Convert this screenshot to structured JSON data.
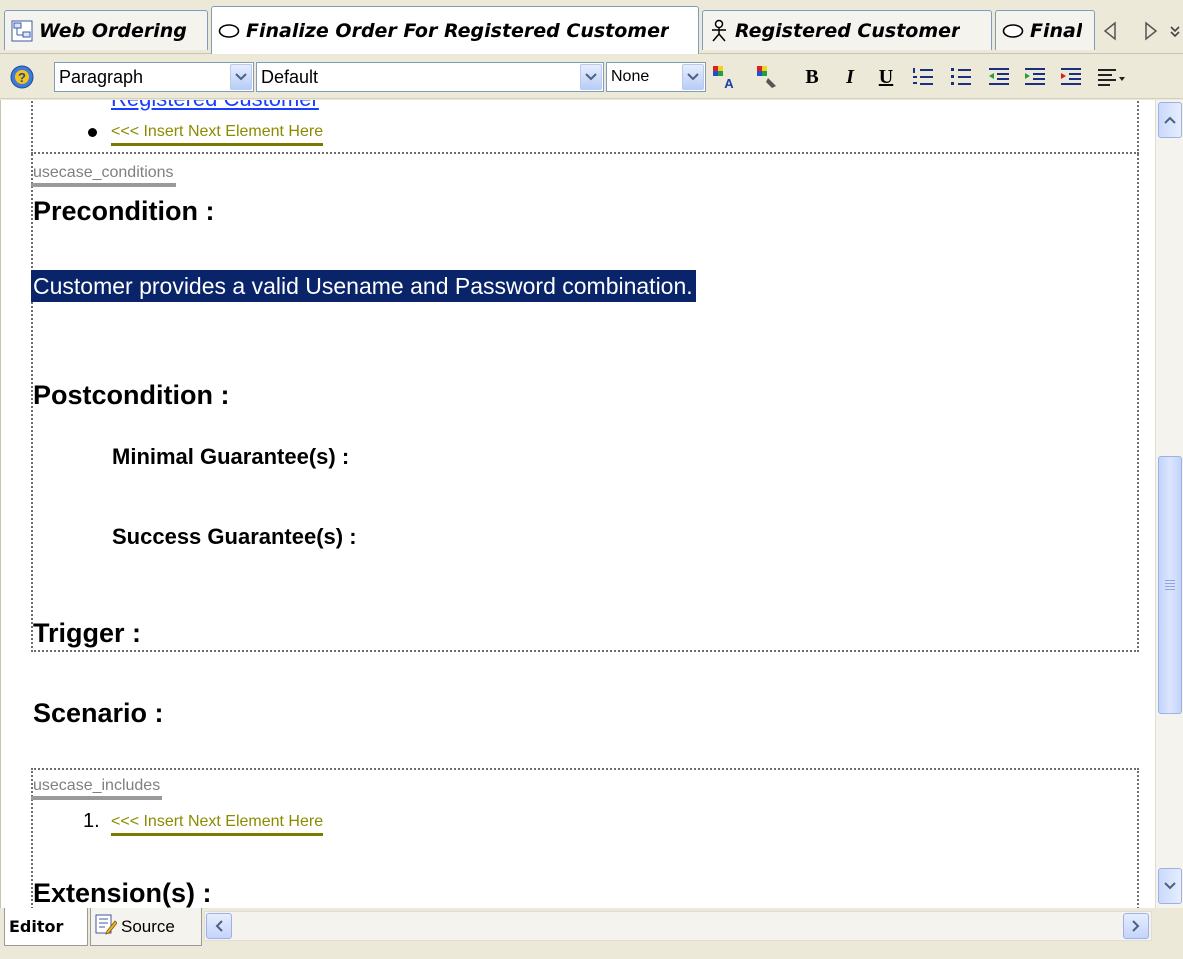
{
  "tabs": [
    {
      "label": "Web Ordering",
      "icon": "diagram-icon",
      "active": false
    },
    {
      "label": "Finalize Order For Registered Customer",
      "icon": "usecase-ellipse-icon",
      "active": true
    },
    {
      "label": "Registered Customer",
      "icon": "actor-icon",
      "active": false
    },
    {
      "label": "Final",
      "icon": "usecase-ellipse-icon",
      "active": false
    }
  ],
  "toolbar": {
    "style_value": "Paragraph",
    "font_value": "Default",
    "size_value": "None",
    "bold_label": "B",
    "italic_label": "I",
    "underline_label": "U"
  },
  "editor": {
    "linked_item_label": "Registered Customer",
    "insert_placeholder": "<<< Insert Next Element Here",
    "conditions_tag": "usecase_conditions",
    "precondition_heading": "Precondition :",
    "precondition_text": "Customer provides a valid Usename and Password combination.",
    "postcondition_heading": "Postcondition :",
    "minimal_guarantee": "Minimal Guarantee(s) :",
    "success_guarantee": "Success Guarantee(s) :",
    "trigger_heading": "Trigger :",
    "scenario_heading": "Scenario :",
    "includes_tag": "usecase_includes",
    "includes_number": "1.",
    "includes_placeholder": "<<< Insert Next Element Here",
    "extensions_heading": "Extension(s) :"
  },
  "bottom_tabs": {
    "editor_label": "Editor",
    "source_label": "Source"
  },
  "colors": {
    "selection_bg": "#0a246a",
    "placeholder_text": "#8b8b00",
    "link_text": "#1a3eff",
    "tab_border": "#7f9db9"
  }
}
